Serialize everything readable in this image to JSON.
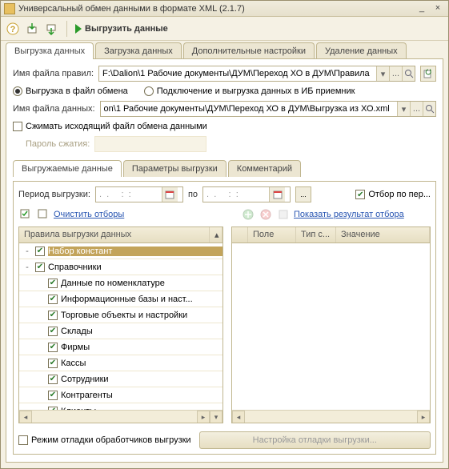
{
  "window": {
    "title": "Универсальный обмен данными в формате XML (2.1.7)",
    "minimize": "_",
    "close": "×"
  },
  "toolbar": {
    "run_label": "Выгрузить данные"
  },
  "main_tabs": {
    "items": [
      "Выгрузка данных",
      "Загрузка данных",
      "Дополнительные настройки",
      "Удаление данных"
    ],
    "active": 0
  },
  "rules_file": {
    "label": "Имя файла правил:",
    "value": "F:\\Dalion\\1 Рабочие документы\\ДУМ\\Переход ХО в ДУМ\\Правила"
  },
  "mode": {
    "to_file": "Выгрузка в файл обмена",
    "to_ib": "Подключение и выгрузка данных в ИБ приемник"
  },
  "data_file": {
    "label": "Имя файла данных:",
    "value": "on\\1 Рабочие документы\\ДУМ\\Переход ХО в ДУМ\\Выгрузка из ХО.xml"
  },
  "compress": {
    "label": "Сжимать исходящий файл обмена данными"
  },
  "pass": {
    "label": "Пароль сжатия:"
  },
  "sub_tabs": {
    "items": [
      "Выгружаемые данные",
      "Параметры выгрузки",
      "Комментарий"
    ],
    "active": 0
  },
  "period": {
    "label": "Период выгрузки:",
    "from_value": ".  .     :  :",
    "to_label": "по",
    "to_value": ".  .     :  :",
    "filter_label": "Отбор по пер..."
  },
  "left_toolbar": {
    "clear_label": "Очистить отборы"
  },
  "right_toolbar": {
    "show_label": "Показать результат отбора"
  },
  "tree": {
    "header": "Правила выгрузки данных",
    "items": [
      {
        "label": "Набор констант",
        "checked": true,
        "selected": true,
        "level": 0,
        "toggle": "-"
      },
      {
        "label": "Справочники",
        "checked": true,
        "level": 0,
        "toggle": "-"
      },
      {
        "label": "Данные по номенклатуре",
        "checked": true,
        "level": 1
      },
      {
        "label": "Информационные базы и наст...",
        "checked": true,
        "level": 1
      },
      {
        "label": "Торговые объекты и настройки",
        "checked": true,
        "level": 1
      },
      {
        "label": "Склады",
        "checked": true,
        "level": 1
      },
      {
        "label": "Фирмы",
        "checked": true,
        "level": 1
      },
      {
        "label": "Кассы",
        "checked": true,
        "level": 1
      },
      {
        "label": "Сотрудники",
        "checked": true,
        "level": 1
      },
      {
        "label": "Контрагенты",
        "checked": true,
        "level": 1
      },
      {
        "label": "Клиенты",
        "checked": true,
        "level": 1
      }
    ]
  },
  "filter_cols": [
    "",
    "Поле",
    "Тип с...",
    "Значение"
  ],
  "footer": {
    "debug_label": "Режим отладки обработчиков выгрузки",
    "config_label": "Настройка отладки выгрузки..."
  }
}
